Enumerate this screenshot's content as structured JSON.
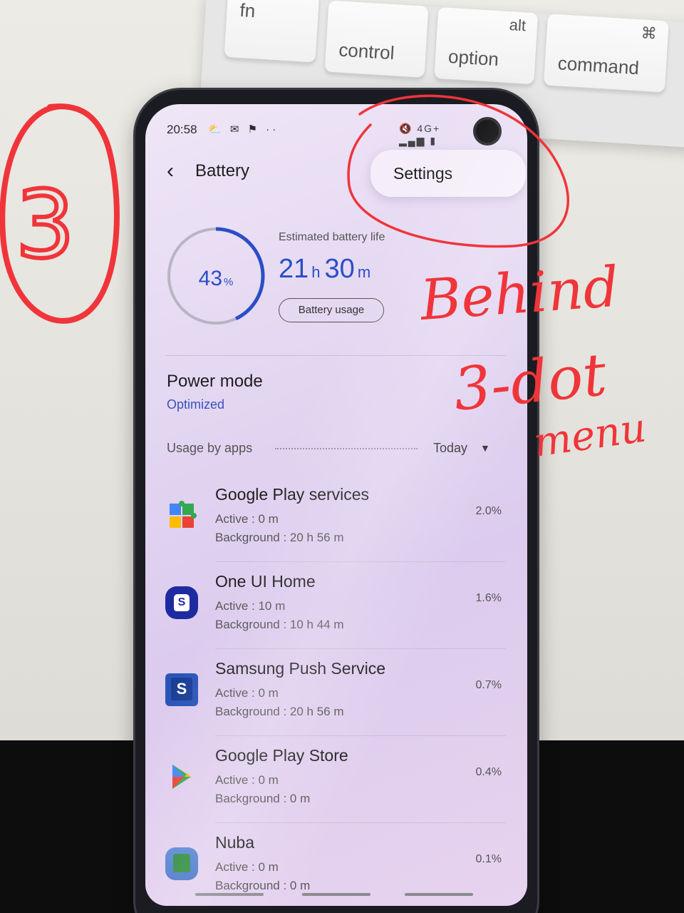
{
  "keyboard": {
    "keys": [
      {
        "label": "fn"
      },
      {
        "label": "control"
      },
      {
        "label": "alt",
        "sub": "option"
      },
      {
        "label": "⌘",
        "sub": "command"
      }
    ]
  },
  "status_bar": {
    "time": "20:58",
    "left_icons": "⛅ ✉ ⚑ ··",
    "right_icons": "🔇 4G+ ▂▄▆ ▮"
  },
  "header": {
    "back_icon": "‹",
    "title": "Battery"
  },
  "menu": {
    "settings_label": "Settings"
  },
  "battery": {
    "percent": "43",
    "percent_unit": "%",
    "level_fraction": 0.43,
    "estimate_label": "Estimated battery life",
    "hours": "21",
    "hours_unit": "h",
    "minutes": "30",
    "minutes_unit": "m",
    "usage_button": "Battery usage",
    "ring_color": "#2b4ec6"
  },
  "power_mode": {
    "title": "Power mode",
    "value": "Optimized"
  },
  "usage": {
    "label": "Usage by apps",
    "period": "Today",
    "caret": "▼"
  },
  "apps": [
    {
      "name": "Google Play services",
      "active": "Active : 0 m",
      "background": "Background : 20 h 56 m",
      "percent": "2.0%",
      "icon": "puzzle-icon"
    },
    {
      "name": "One UI Home",
      "active": "Active : 10 m",
      "background": "Background : 10 h 44 m",
      "percent": "1.6%",
      "icon": "home-s-icon"
    },
    {
      "name": "Samsung Push Service",
      "active": "Active : 0 m",
      "background": "Background : 20 h 56 m",
      "percent": "0.7%",
      "icon": "push-s-icon"
    },
    {
      "name": "Google Play Store",
      "active": "Active : 0 m",
      "background": "Background : 0 m",
      "percent": "0.4%",
      "icon": "play-store-icon"
    },
    {
      "name": "Nuba",
      "active": "Active : 0 m",
      "background": "Background : 0 m",
      "percent": "0.1%",
      "icon": "nuba-icon"
    }
  ],
  "annotations": {
    "step_number": "3",
    "note_line1": "Behind",
    "note_line2": "3-dot",
    "note_line3": "menu",
    "color": "#f0353a"
  }
}
